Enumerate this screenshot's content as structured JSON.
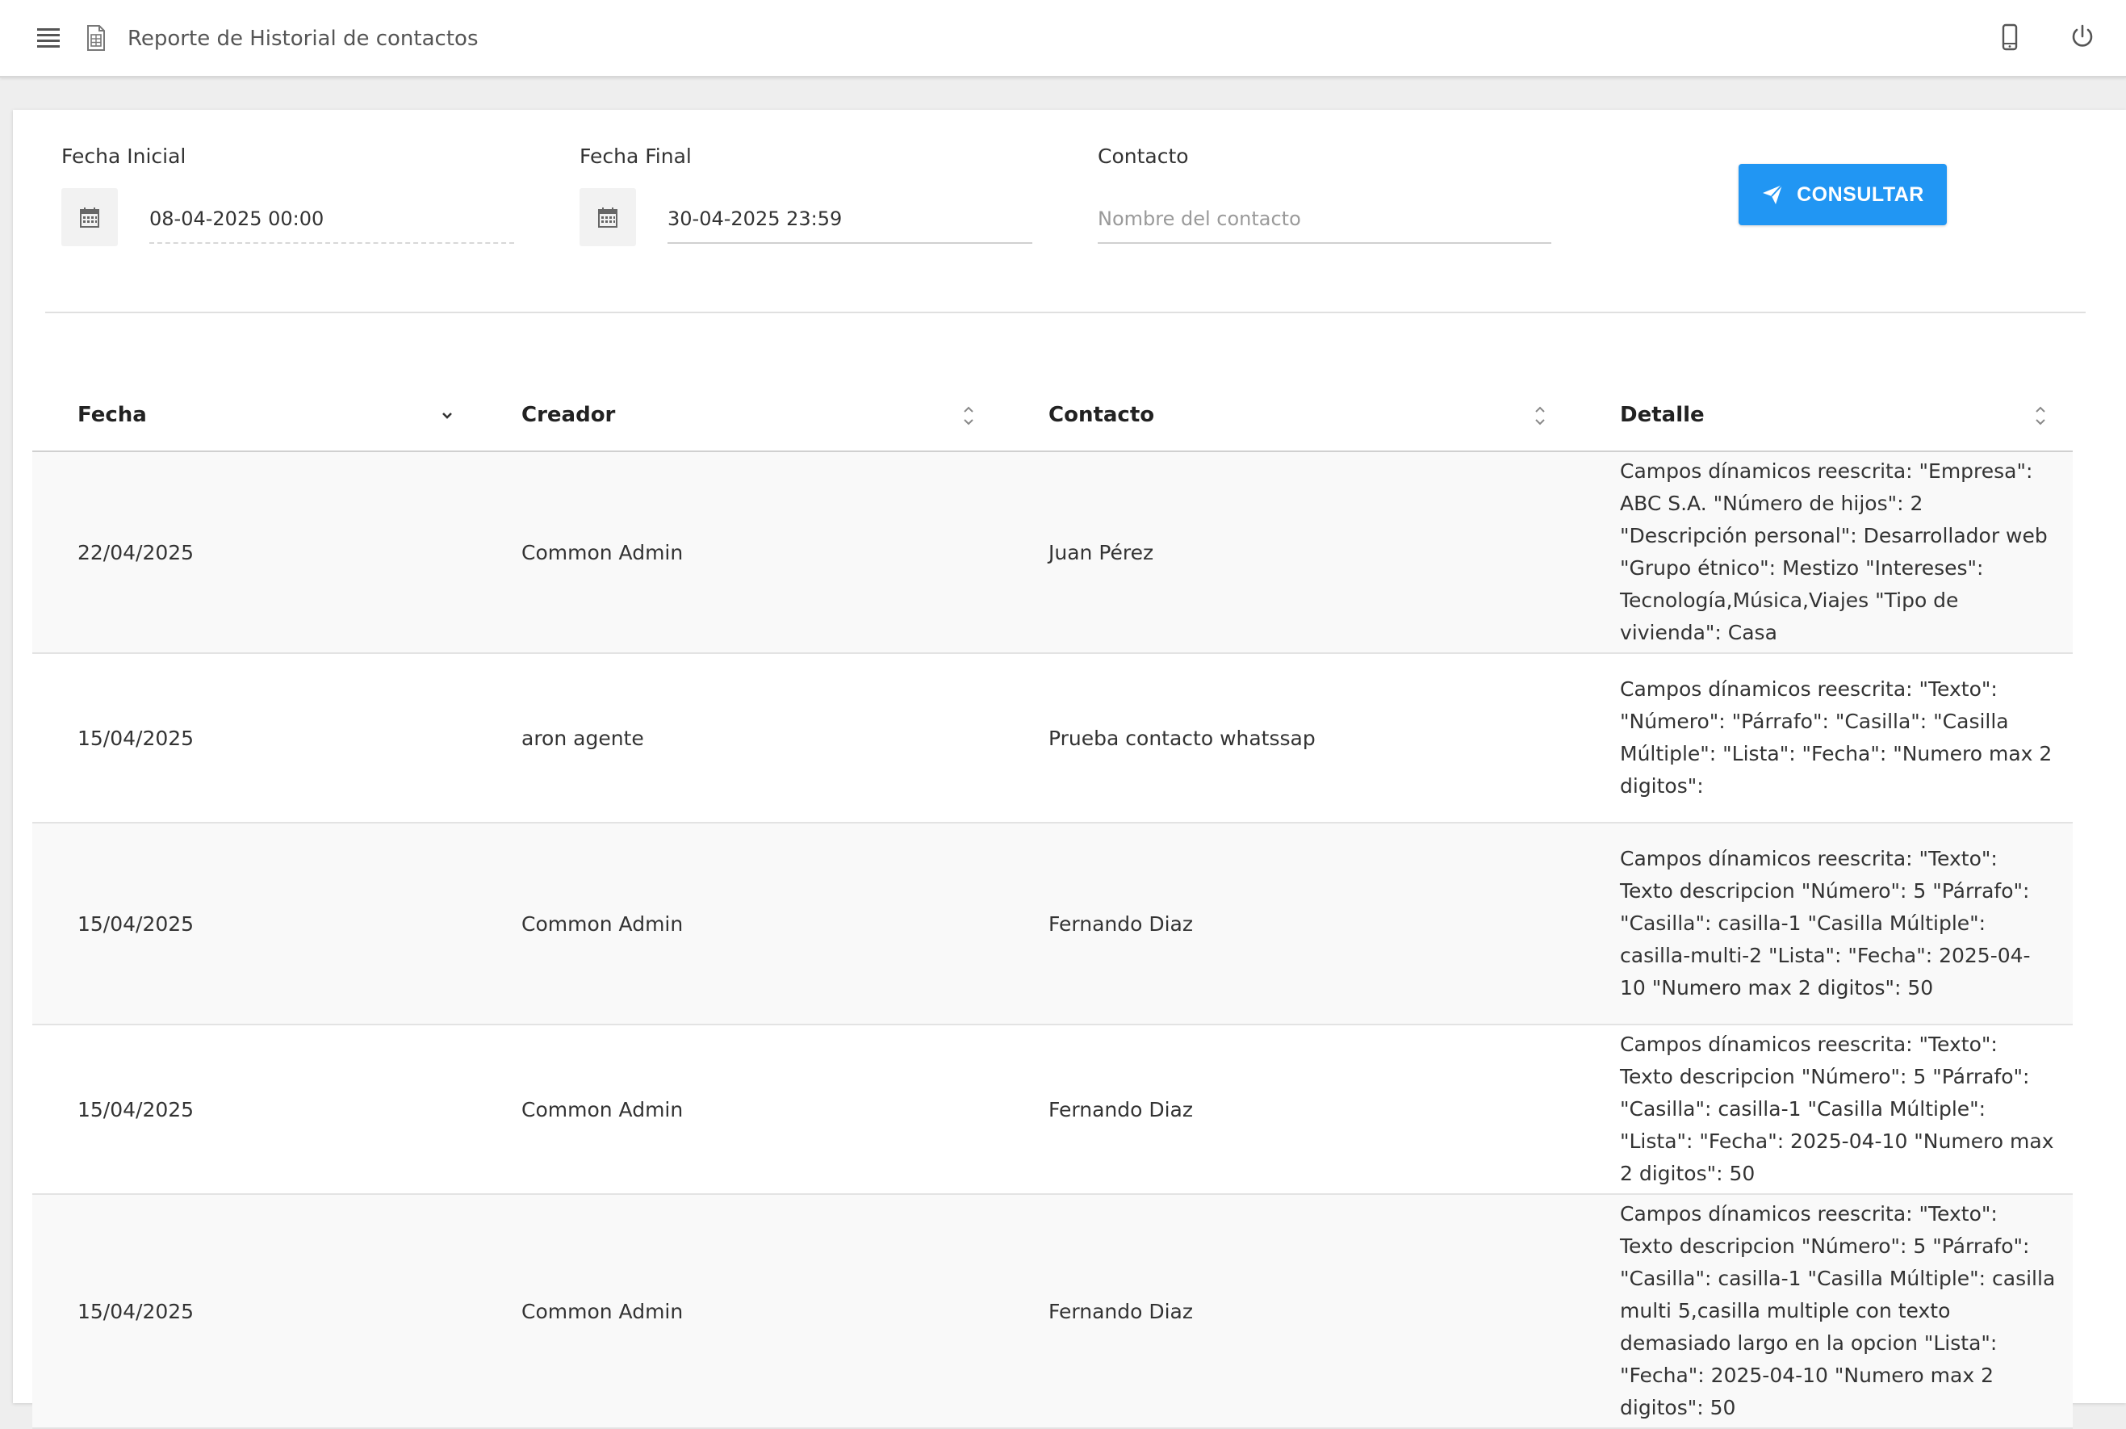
{
  "header": {
    "title": "Reporte de Historial de contactos",
    "icons": {
      "menu": "hamburger-menu-icon",
      "doc": "spreadsheet-icon",
      "phone": "mobile-phone-icon",
      "power": "power-icon"
    }
  },
  "filters": {
    "fecha_inicial": {
      "label": "Fecha Inicial",
      "value": "08-04-2025 00:00"
    },
    "fecha_final": {
      "label": "Fecha Final",
      "value": "30-04-2025 23:59"
    },
    "contacto": {
      "label": "Contacto",
      "value": "",
      "placeholder": "Nombre del contacto"
    },
    "consultar_label": "CONSULTAR"
  },
  "colors": {
    "accent": "#2196f3"
  },
  "table": {
    "columns": [
      "Fecha",
      "Creador",
      "Contacto",
      "Detalle"
    ],
    "rows": [
      {
        "fecha": "22/04/2025",
        "creador": "Common Admin",
        "contacto": "Juan Pérez",
        "detalle": "Campos dínamicos reescrita: \"Empresa\": ABC S.A. \"Número de hijos\": 2 \"Descripción personal\": Desarrollador web \"Grupo étnico\": Mestizo \"Intereses\": Tecnología,Música,Viajes \"Tipo de vivienda\": Casa"
      },
      {
        "fecha": "15/04/2025",
        "creador": "aron agente",
        "contacto": "Prueba contacto whatssap",
        "detalle": "Campos dínamicos reescrita: \"Texto\": \"Número\": \"Párrafo\": \"Casilla\": \"Casilla Múltiple\": \"Lista\": \"Fecha\": \"Numero max 2 digitos\":"
      },
      {
        "fecha": "15/04/2025",
        "creador": "Common Admin",
        "contacto": "Fernando Diaz",
        "detalle": "Campos dínamicos reescrita: \"Texto\": Texto descripcion \"Número\": 5 \"Párrafo\": \"Casilla\": casilla-1 \"Casilla Múltiple\": casilla-multi-2 \"Lista\": \"Fecha\": 2025-04-10 \"Numero max 2 digitos\": 50"
      },
      {
        "fecha": "15/04/2025",
        "creador": "Common Admin",
        "contacto": "Fernando Diaz",
        "detalle": "Campos dínamicos reescrita: \"Texto\": Texto descripcion \"Número\": 5 \"Párrafo\": \"Casilla\": casilla-1 \"Casilla Múltiple\": \"Lista\": \"Fecha\": 2025-04-10 \"Numero max 2 digitos\": 50"
      },
      {
        "fecha": "15/04/2025",
        "creador": "Common Admin",
        "contacto": "Fernando Diaz",
        "detalle": "Campos dínamicos reescrita: \"Texto\": Texto descripcion \"Número\": 5 \"Párrafo\": \"Casilla\": casilla-1 \"Casilla Múltiple\": casilla multi 5,casilla multiple con texto demasiado largo en la opcion \"Lista\": \"Fecha\": 2025-04-10 \"Numero max 2 digitos\": 50"
      }
    ]
  }
}
